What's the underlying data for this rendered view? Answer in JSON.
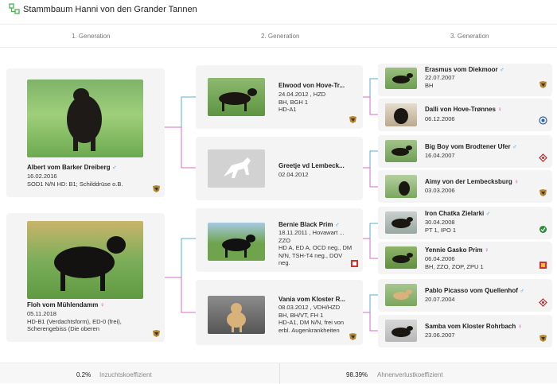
{
  "header": {
    "title": "Stammbaum Hanni von den Grander Tannen"
  },
  "generations": [
    "1. Generation",
    "2. Generation",
    "3. Generation"
  ],
  "gen1": [
    {
      "name": "Albert vom Barker Dreiberg",
      "sex": "♂",
      "info": "16.02.2016\nSOD1 N/N HD: B1; Schilddrüse o.B."
    },
    {
      "name": "Floh vom Mühlendamm",
      "sex": "♀",
      "info": "05.11.2018\nHD-B1 (Verdachtsform), ED-0 (frei),\nScherengebiss (Die oberen"
    }
  ],
  "gen2": [
    {
      "name": "Elwood von Hove-Tr...",
      "sex": "",
      "info": "24.04.2012 , HZD\nBH, BGH 1\nHD-A1"
    },
    {
      "name": "Greetje vd Lembeck...",
      "sex": "",
      "info": "02.04.2012"
    },
    {
      "name": "Bernie Black Prim",
      "sex": "♂",
      "info": "18.11.2011 , Hovawart ...\nZZO\nHD A, ED A, OCD neg., DM\nN/N, TSH-T4 neg., DOV\nneg."
    },
    {
      "name": "Vania vom Kloster R...",
      "sex": "",
      "info": "08.03.2012 , VDH/HZD\nBH, BH/VT, FH 1\nHD-A1, DM N/N, frei von\nerbl. Augenkrankheiten"
    }
  ],
  "gen3": [
    {
      "name": "Erasmus vom Diekmoor",
      "sex": "♂",
      "info": "22.07.2007\nBH"
    },
    {
      "name": "Dalli von Hove-Trønnes",
      "sex": "♀",
      "info": "06.12.2006"
    },
    {
      "name": "Big Boy vom Brodtener Ufer",
      "sex": "♂",
      "info": "16.04.2007"
    },
    {
      "name": "Aimy von der Lembecksburg",
      "sex": "♀",
      "info": "03.03.2006"
    },
    {
      "name": "Iron Chatka Zielarki",
      "sex": "♂",
      "info": "30.04.2008\nPT 1, IPO 1"
    },
    {
      "name": "Yennie Gasko Prim",
      "sex": "♀",
      "info": "06.04.2006\nBH, ZZO, ZOP, ZPU 1"
    },
    {
      "name": "Pablo Picasso vom Quellenhof",
      "sex": "♂",
      "info": "20.07.2004"
    },
    {
      "name": "Samba vom Kloster Rohrbach",
      "sex": "♀",
      "info": "23.06.2007"
    }
  ],
  "footer": {
    "inbreeding_value": "0.2%",
    "inbreeding_label": "Inzuchtskoeffizient",
    "ancestor_value": "98.39%",
    "ancestor_label": "Ahnenverlustkoeffizient"
  },
  "colors": {
    "male_line": "#5aaed6",
    "female_line": "#d96cc8"
  }
}
